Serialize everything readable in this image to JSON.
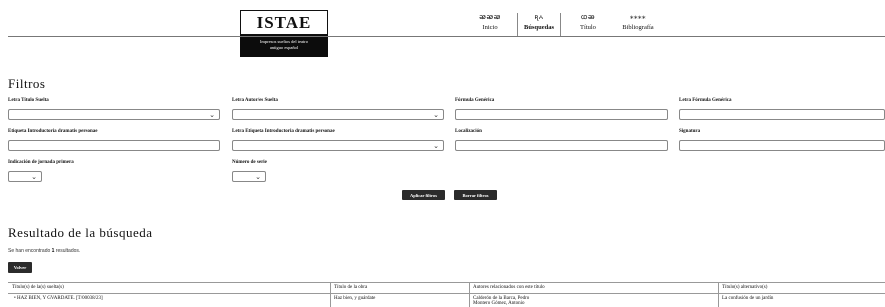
{
  "header": {
    "logo_title": "ISTAE",
    "logo_subtitle_1": "Impresos sueltos del teatro",
    "logo_subtitle_2": "antiguo español",
    "nav": [
      {
        "icon": "ꭁꭁꭁ",
        "label": "Inicio",
        "icon_name": "ornament-icon"
      },
      {
        "icon": "ꭆꭅ",
        "label": "Búsquedas",
        "icon_name": "ornament-icon"
      },
      {
        "icon": "ꭃꭂ",
        "label": "Título",
        "icon_name": "ornament-icon"
      },
      {
        "icon": "⁎⁎⁎⁎",
        "label": "Bibliografía",
        "icon_name": "ornament-icon"
      }
    ]
  },
  "filters": {
    "title": "Filtros",
    "fields": {
      "letra_titulo_suelta": {
        "label": "Letra Título Suelta",
        "value": ""
      },
      "letra_autor_suelta": {
        "label": "Letra Autor/es Suelta",
        "value": ""
      },
      "formula_generica": {
        "label": "Fórmula Genérica",
        "value": ""
      },
      "letra_formula_generica": {
        "label": "Letra Fórmula Genérica",
        "value": ""
      },
      "etiqueta_introductoria": {
        "label": "Etiqueta Introductoria dramatis personae",
        "value": ""
      },
      "letra_etiqueta_introductoria": {
        "label": "Letra Etiqueta Introductoria dramatis personae",
        "value": ""
      },
      "localizacion": {
        "label": "Localización",
        "value": ""
      },
      "signatura": {
        "label": "Signatura",
        "value": ""
      },
      "indicacion_jornada": {
        "label": "Indicación de jornada primera",
        "value": ""
      },
      "numero_serie": {
        "label": "Número de serie",
        "value": ""
      }
    },
    "apply_label": "Aplicar filtros",
    "clear_label": "Borrar filtros"
  },
  "results": {
    "title": "Resultado de la búsqueda",
    "count_prefix": "Se han encontrado ",
    "count": "1",
    "count_suffix": " resultados.",
    "back_label": "Volver",
    "columns": [
      "Título(s) de la(s) suelta(s)",
      "Título de la obra",
      "Autores relacionados con este título",
      "Título(s) alternativo(s)"
    ],
    "rows": [
      {
        "suelta": "HAZ BIEN, Y GVARDATE. [T/00038/23]",
        "obra": "Haz bien, y guárdate",
        "autores": "Calderón de la Barca, Pedro",
        "autores_2": "Montero Gómez, Antonio",
        "alternativo": "La confusión de un jardín"
      }
    ]
  }
}
